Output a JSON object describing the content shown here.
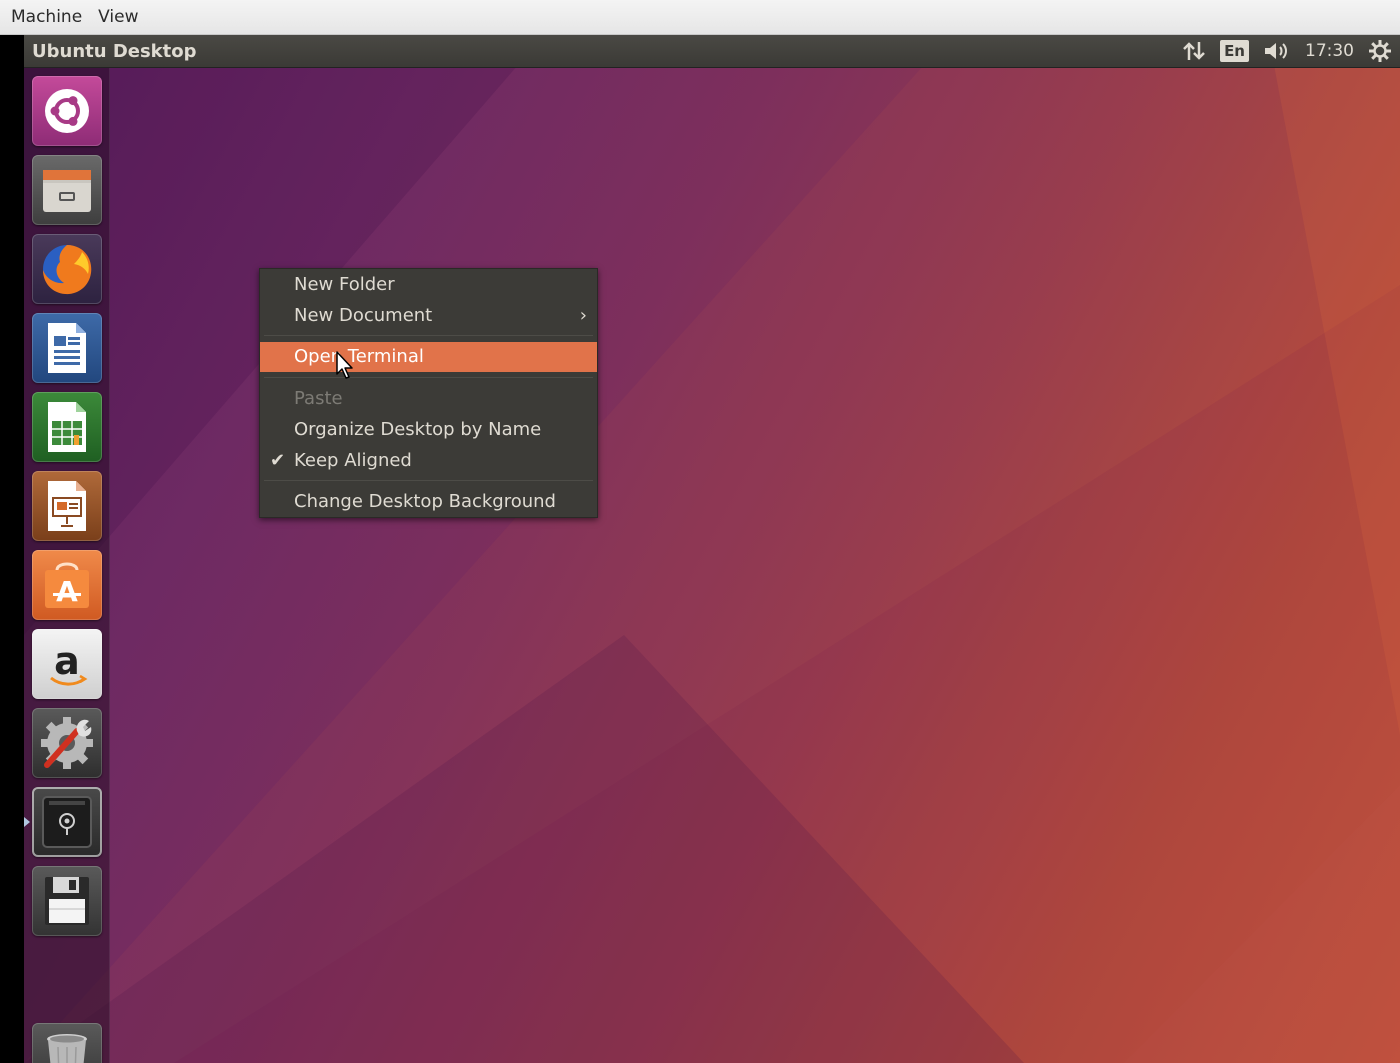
{
  "vm_menubar": {
    "items": [
      "Machine",
      "View"
    ]
  },
  "top_panel": {
    "title": "Ubuntu Desktop",
    "keyboard_layout": "En",
    "clock": "17:30",
    "icons": [
      "network-updown-icon",
      "volume-icon",
      "session-gear-icon"
    ]
  },
  "launcher": {
    "items": [
      {
        "name": "dash-home",
        "icon": "ubuntu-logo-icon"
      },
      {
        "name": "files",
        "icon": "file-cabinet-icon"
      },
      {
        "name": "firefox",
        "icon": "firefox-icon"
      },
      {
        "name": "libreoffice-writer",
        "icon": "writer-document-icon"
      },
      {
        "name": "libreoffice-calc",
        "icon": "calc-spreadsheet-icon"
      },
      {
        "name": "libreoffice-impress",
        "icon": "impress-presentation-icon"
      },
      {
        "name": "ubuntu-software",
        "icon": "software-bag-icon"
      },
      {
        "name": "amazon",
        "icon": "amazon-icon"
      },
      {
        "name": "system-settings",
        "icon": "settings-wrench-icon"
      },
      {
        "name": "disk-app",
        "icon": "safe-disk-icon",
        "active": true
      },
      {
        "name": "save-disk",
        "icon": "floppy-icon"
      },
      {
        "name": "trash",
        "icon": "trash-icon"
      }
    ]
  },
  "context_menu": {
    "items": [
      {
        "label": "New Folder"
      },
      {
        "label": "New Document",
        "submenu": true
      },
      {
        "label": "Open Terminal",
        "highlighted": true
      },
      {
        "label": "Paste",
        "disabled": true
      },
      {
        "label": "Organize Desktop by Name"
      },
      {
        "label": "Keep Aligned",
        "checked": true
      },
      {
        "label": "Change Desktop Background"
      }
    ],
    "submenu_glyph": "›",
    "check_glyph": "✔"
  },
  "colors": {
    "highlight": "#e1734a",
    "menu_bg": "#3c3b37",
    "panel_bg": "#3b3a36"
  }
}
